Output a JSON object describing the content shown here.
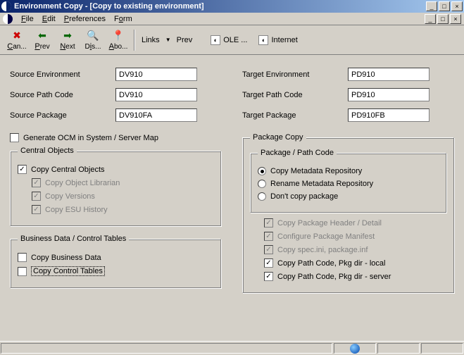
{
  "window": {
    "title": "Environment Copy - [Copy to existing environment]",
    "min": "_",
    "max": "□",
    "close": "×"
  },
  "menu": {
    "file": "File",
    "edit": "Edit",
    "preferences": "Preferences",
    "form": "Form"
  },
  "toolbar": {
    "cancel": "Can...",
    "prev": "Prev",
    "next": "Next",
    "dis": "Dis...",
    "abo": "Abo...",
    "links": "Links",
    "prev_link": "Prev",
    "ole": "OLE ...",
    "internet": "Internet"
  },
  "fields": {
    "src_env_lbl": "Source Environment",
    "src_env_val": "DV910",
    "src_path_lbl": "Source Path Code",
    "src_path_val": "DV910",
    "src_pkg_lbl": "Source Package",
    "src_pkg_val": "DV910FA",
    "tgt_env_lbl": "Target Environment",
    "tgt_env_val": "PD910",
    "tgt_path_lbl": "Target Path Code",
    "tgt_path_val": "PD910",
    "tgt_pkg_lbl": "Target Package",
    "tgt_pkg_val": "PD910FB"
  },
  "ocm": "Generate OCM in System / Server Map",
  "central": {
    "legend": "Central Objects",
    "copy_central": "Copy Central Objects",
    "copy_obj_lib": "Copy Object Librarian",
    "copy_versions": "Copy Versions",
    "copy_esu": "Copy ESU History"
  },
  "biz": {
    "legend": "Business Data / Control Tables",
    "copy_biz": "Copy Business Data",
    "copy_ctrl": "Copy Control Tables"
  },
  "pkg": {
    "legend": "Package Copy",
    "ppc_legend": "Package / Path Code",
    "r_copy": "Copy Metadata Repository",
    "r_rename": "Rename Metadata Repository",
    "r_dont": "Don't copy package",
    "hdr": "Copy Package Header / Detail",
    "manifest": "Configure Package Manifest",
    "spec": "Copy spec.ini, package.inf",
    "local": "Copy Path Code, Pkg dir - local",
    "server": "Copy Path Code, Pkg dir - server"
  },
  "check": "✓"
}
